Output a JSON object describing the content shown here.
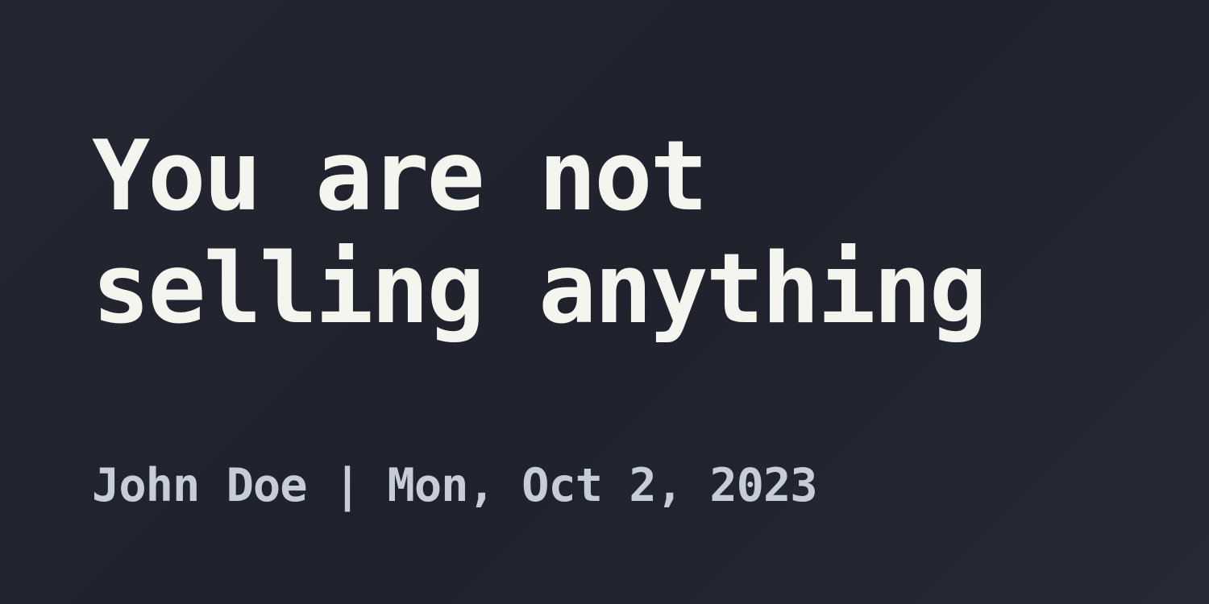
{
  "post": {
    "title": "You are not\nselling anything",
    "author": "John Doe",
    "separator": "|",
    "date": "Mon, Oct 2, 2023"
  },
  "colors": {
    "background": "#22252f",
    "title": "#f5f5ef",
    "meta": "#c7cdd8"
  }
}
